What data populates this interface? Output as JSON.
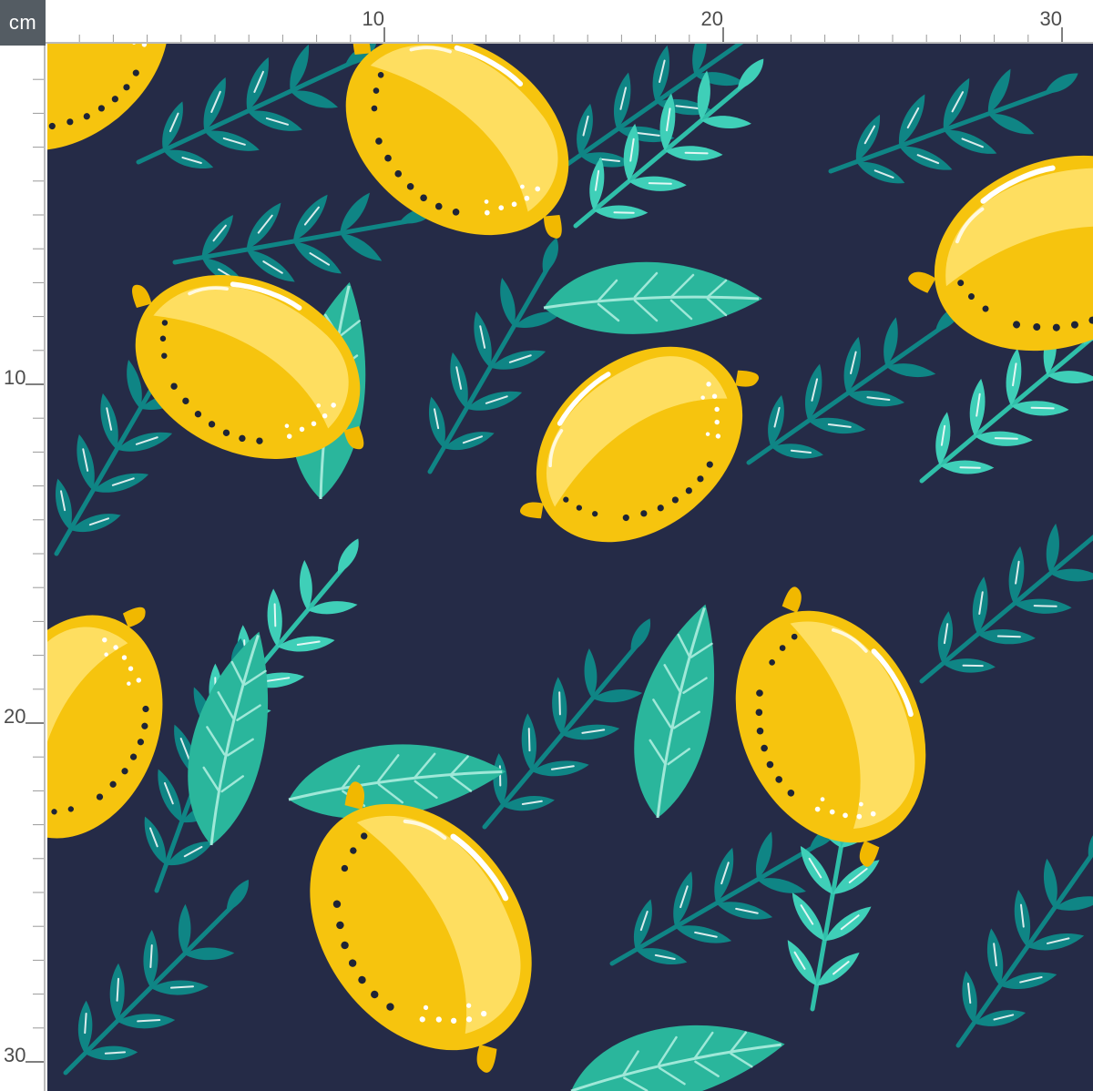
{
  "ruler": {
    "unit": "cm",
    "top_labels": [
      "10",
      "20",
      "30"
    ],
    "left_labels": [
      "10",
      "20",
      "30"
    ]
  },
  "fabric": {
    "motifs": [
      "lemon-icon",
      "fern-leaf-icon",
      "broad-leaf-icon"
    ],
    "colors": {
      "background": "#252b47",
      "lemon": "#f6c40e",
      "lemon_highlight": "#ffe36e",
      "leaf_dark": "#0f8585",
      "leaf_light": "#3fcfb8",
      "broad_leaf": "#2ab69c",
      "seed_dots": "#1e2436"
    }
  }
}
